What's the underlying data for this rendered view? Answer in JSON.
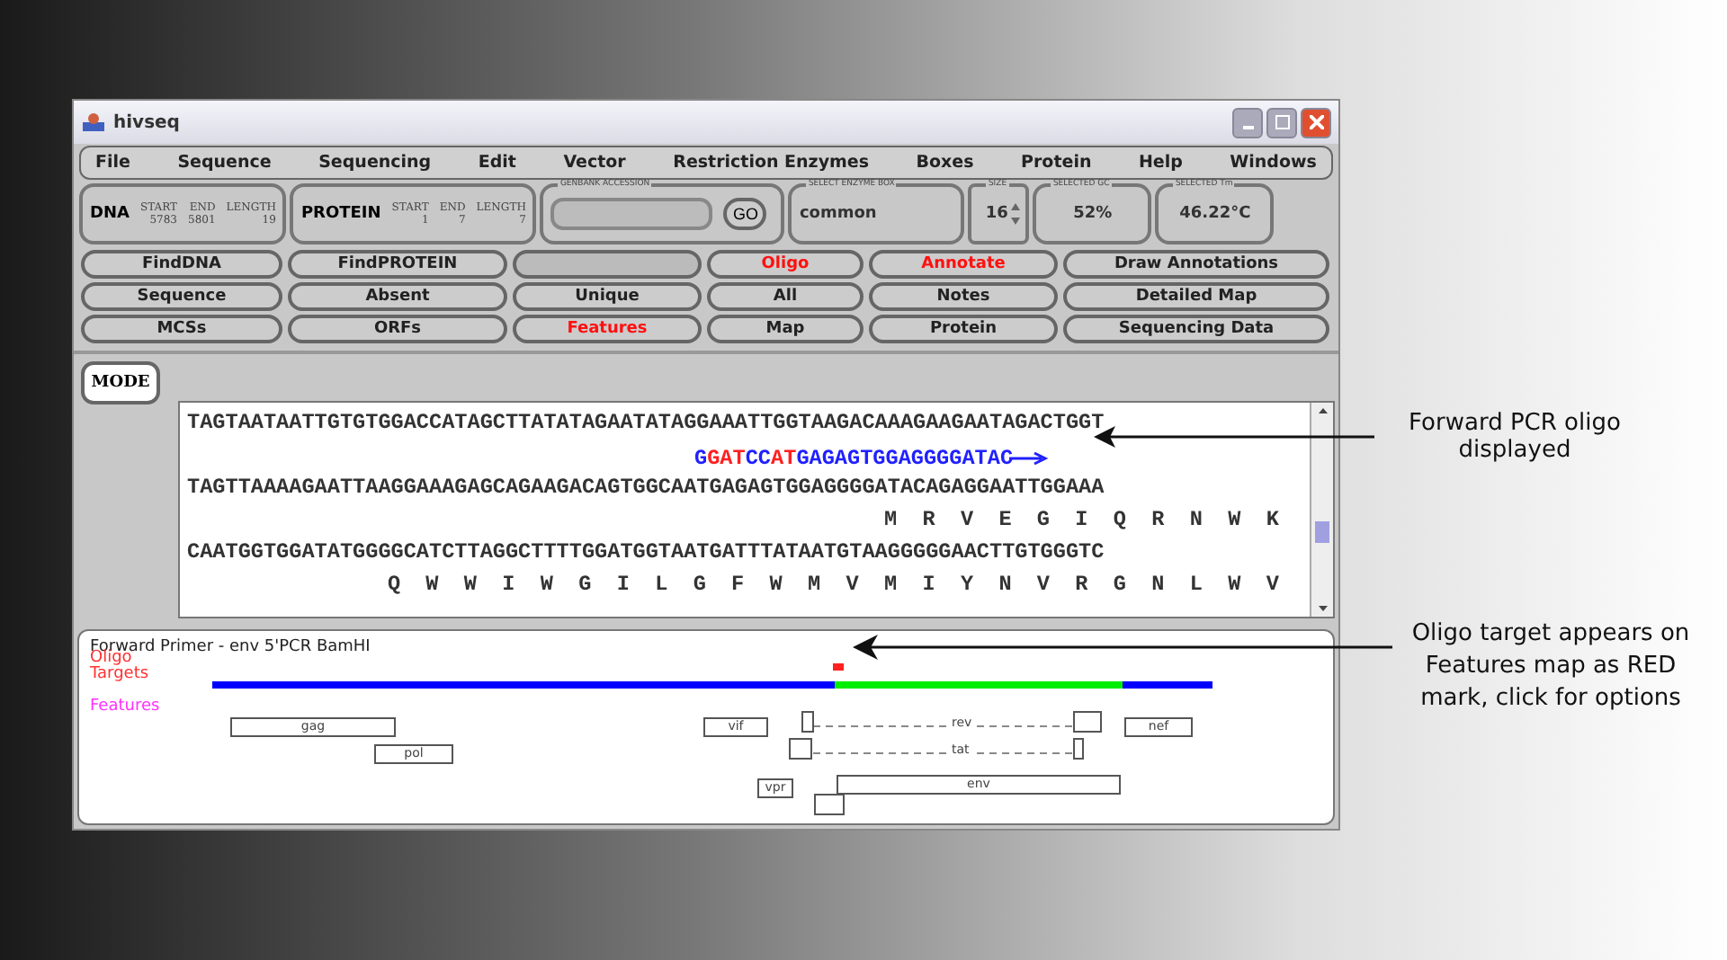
{
  "window": {
    "title": "hivseq"
  },
  "menu": [
    "File",
    "Sequence",
    "Sequencing",
    "Edit",
    "Vector",
    "Restriction Enzymes",
    "Boxes",
    "Protein",
    "Help",
    "Windows"
  ],
  "dna": {
    "label": "DNA",
    "fields": [
      {
        "label": "START",
        "value": "5783"
      },
      {
        "label": "END",
        "value": "5801"
      },
      {
        "label": "LENGTH",
        "value": "19"
      }
    ]
  },
  "protein": {
    "label": "PROTEIN",
    "fields": [
      {
        "label": "START",
        "value": "1"
      },
      {
        "label": "END",
        "value": "7"
      },
      {
        "label": "LENGTH",
        "value": "7"
      }
    ]
  },
  "genbank": {
    "label": "GENBANK ACCESSION",
    "button": "GO"
  },
  "enzyme_box": {
    "label": "SELECT ENZYME BOX",
    "value": "common"
  },
  "size": {
    "label": "SIZE",
    "value": "16"
  },
  "gc": {
    "label": "SELECTED GC",
    "value": "52%"
  },
  "tm": {
    "label": "SELECTED Tm",
    "value": "46.22°C"
  },
  "buttons": [
    {
      "label": "FindDNA",
      "highlighted": false,
      "disabled": false
    },
    {
      "label": "FindPROTEIN",
      "highlighted": false,
      "disabled": false
    },
    {
      "disabled": true
    },
    {
      "label": "Oligo",
      "highlighted": true,
      "disabled": false
    },
    {
      "label": "Annotate",
      "highlighted": true,
      "disabled": false
    },
    {
      "label": "Draw Annotations",
      "highlighted": false,
      "disabled": false
    },
    {
      "label": "Sequence",
      "highlighted": false,
      "disabled": false
    },
    {
      "label": "Absent",
      "highlighted": false,
      "disabled": false
    },
    {
      "label": "Unique",
      "highlighted": false,
      "disabled": false
    },
    {
      "label": "All",
      "highlighted": false,
      "disabled": false
    },
    {
      "label": "Notes",
      "highlighted": false,
      "disabled": false
    },
    {
      "label": "Detailed Map",
      "highlighted": false,
      "disabled": false
    },
    {
      "label": "MCSs",
      "highlighted": false,
      "disabled": false
    },
    {
      "label": "ORFs",
      "highlighted": false,
      "disabled": false
    },
    {
      "label": "Features",
      "highlighted": true,
      "disabled": false
    },
    {
      "label": "Map",
      "highlighted": false,
      "disabled": false
    },
    {
      "label": "Protein",
      "highlighted": false,
      "disabled": false
    },
    {
      "label": "Sequencing Data",
      "highlighted": false,
      "disabled": false
    }
  ],
  "mode_button": "MODE",
  "sequence_lines": [
    {
      "kind": "dna",
      "text": "TAGTAATAATTGTGTGGACCATAGCTTATATAGAATATAGGAAATTGGTAAGACAAAGAAGAATAGACTGGT"
    },
    {
      "kind": "oligo",
      "segments": [
        {
          "text": "G",
          "color": "#2020ff"
        },
        {
          "text": "GAT",
          "color": "#ff2020"
        },
        {
          "text": "CC",
          "color": "#2020ff"
        },
        {
          "text": "AT",
          "color": "#ff2020"
        },
        {
          "text": "GAGAGTGGAGGGGATAC",
          "color": "#2020ff"
        }
      ]
    },
    {
      "kind": "dna",
      "text": "TAGTTAAAAGAATTAAGGAAAGAGCAGAAGACAGTGGCAATGAGAGTGGAGGGGATACAGAGGAATTGGAAA"
    },
    {
      "kind": "protein",
      "residues": [
        "M",
        "R",
        "V",
        "E",
        "G",
        "I",
        "Q",
        "R",
        "N",
        "W",
        "K"
      ]
    },
    {
      "kind": "dna",
      "text": "CAATGGTGGATATGGGGCATCTTAGGCTTTTGGATGGTAATGATTTATAATGTAAGGGGGAACTTGTGGGTC"
    },
    {
      "kind": "protein",
      "residues": [
        "Q",
        "W",
        "W",
        "I",
        "W",
        "G",
        "I",
        "L",
        "G",
        "F",
        "W",
        "M",
        "V",
        "M",
        "I",
        "Y",
        "N",
        "V",
        "R",
        "G",
        "N",
        "L",
        "W",
        "V"
      ]
    }
  ],
  "map": {
    "title": "Forward Primer - env 5'PCR BamHI",
    "tracks": [
      {
        "label": "Oligo",
        "color": "#ff3030"
      },
      {
        "label": "Targets",
        "color": "#ff3030"
      },
      {
        "label": "Features",
        "color": "#ff30ff"
      }
    ],
    "features": [
      "gag",
      "pol",
      "vif",
      "vpr",
      "rev",
      "tat",
      "env",
      "nef"
    ]
  },
  "callouts": [
    "Forward PCR oligo displayed",
    "Oligo target appears on Features map as RED mark, click for options"
  ]
}
